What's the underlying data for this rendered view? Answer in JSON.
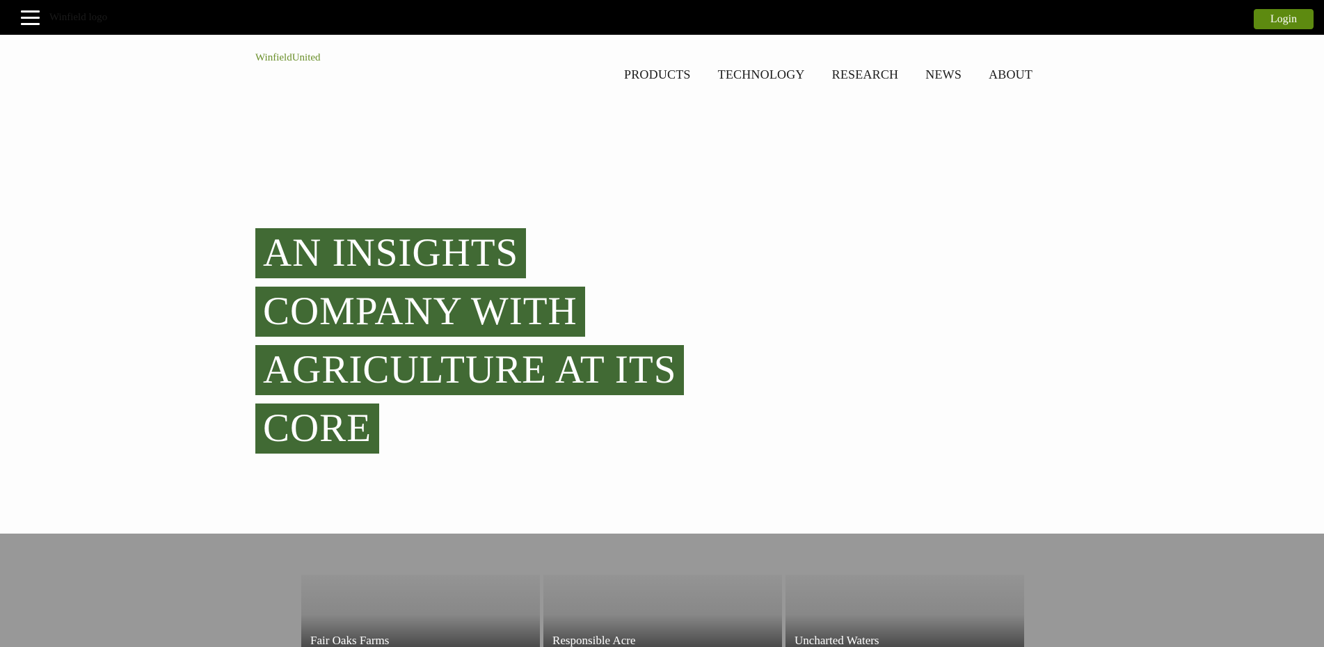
{
  "topbar": {
    "logo_alt": "Winfield logo",
    "login_label": "Login",
    "login_color": "#5d8a10"
  },
  "header": {
    "brand": "WinfieldUnited",
    "nav": [
      "PRODUCTS",
      "TECHNOLOGY",
      "RESEARCH",
      "NEWS",
      "ABOUT"
    ]
  },
  "hero": {
    "lines": [
      "AN INSIGHTS",
      "COMPANY WITH",
      "AGRICULTURE AT ITS",
      "CORE"
    ],
    "highlight_color": "#416a34"
  },
  "cards": [
    {
      "title": "Fair Oaks Farms"
    },
    {
      "title": "Responsible Acre"
    },
    {
      "title": "Uncharted Waters"
    }
  ]
}
